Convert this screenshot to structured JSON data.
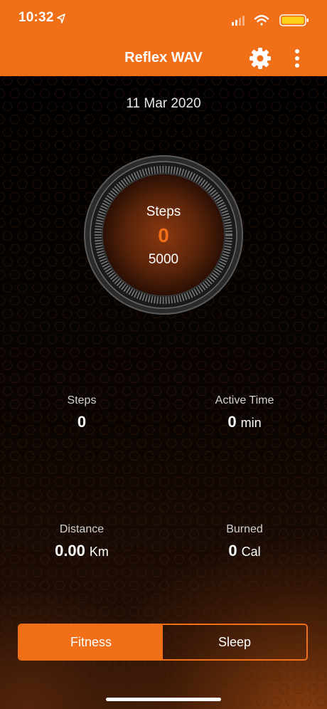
{
  "status_bar": {
    "time": "10:32",
    "icons": [
      "location-arrow-icon",
      "cellular-signal-icon",
      "wifi-icon",
      "battery-icon"
    ]
  },
  "nav": {
    "title": "Reflex WAV",
    "icons": [
      "gear-icon",
      "more-vertical-icon"
    ]
  },
  "date": "11 Mar 2020",
  "ring": {
    "label": "Steps",
    "value": "0",
    "goal": "5000"
  },
  "stats": {
    "steps": {
      "label": "Steps",
      "value": "0",
      "unit": ""
    },
    "active_time": {
      "label": "Active Time",
      "value": "0",
      "unit": "min"
    },
    "distance": {
      "label": "Distance",
      "value": "0.00",
      "unit": "Km"
    },
    "burned": {
      "label": "Burned",
      "value": "0",
      "unit": "Cal"
    }
  },
  "tabs": [
    {
      "label": "Fitness",
      "active": true
    },
    {
      "label": "Sleep",
      "active": false
    }
  ],
  "colors": {
    "accent": "#F06F17",
    "background": "#000000",
    "text": "#FFFFFF"
  }
}
